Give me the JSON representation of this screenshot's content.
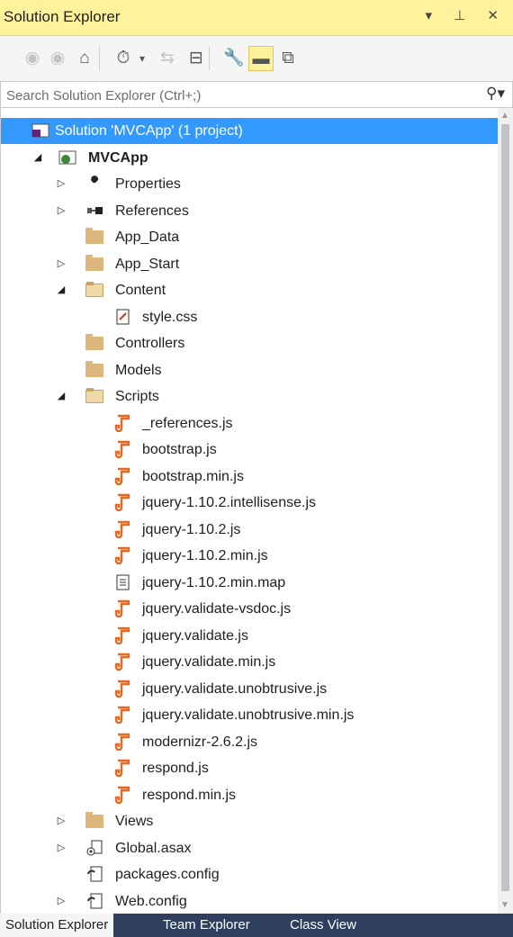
{
  "panel": {
    "title": "Solution Explorer",
    "controls": "▾ ⊥ ✕"
  },
  "toolbar": {
    "buttons": [
      {
        "name": "back-icon",
        "glyph": "◉"
      },
      {
        "name": "forward-icon",
        "glyph": "◉"
      },
      {
        "name": "home-icon",
        "glyph": "⌂"
      },
      {
        "name": "pending-changes-filter-icon",
        "glyph": "⏱"
      },
      {
        "name": "dropdown-icon",
        "glyph": "▾"
      },
      {
        "name": "sync-icon",
        "glyph": "⇆"
      },
      {
        "name": "collapse-all-icon",
        "glyph": "⊟"
      },
      {
        "name": "properties-icon",
        "glyph": "🔧"
      },
      {
        "name": "preview-selected-icon",
        "glyph": "▬"
      },
      {
        "name": "show-all-files-icon",
        "glyph": "⧉"
      }
    ]
  },
  "search": {
    "placeholder": "Search Solution Explorer (Ctrl+;)"
  },
  "tree": [
    {
      "label": "Solution 'MVCApp' (1 project)",
      "icon": "solution-icon",
      "level": 0,
      "arrow": "",
      "selected": true,
      "bold": false
    },
    {
      "label": "MVCApp",
      "icon": "web-project-icon",
      "level": 0,
      "arrow": "◢",
      "selected": false,
      "bold": true
    },
    {
      "label": "Properties",
      "icon": "wrench-icon",
      "level": 1,
      "arrow": "▷",
      "selected": false,
      "bold": false
    },
    {
      "label": "References",
      "icon": "references-icon",
      "level": 1,
      "arrow": "▷",
      "selected": false,
      "bold": false
    },
    {
      "label": "App_Data",
      "icon": "folder-icon",
      "level": 1,
      "arrow": "",
      "selected": false,
      "bold": false
    },
    {
      "label": "App_Start",
      "icon": "folder-icon",
      "level": 1,
      "arrow": "▷",
      "selected": false,
      "bold": false
    },
    {
      "label": "Content",
      "icon": "folder-open-icon",
      "level": 1,
      "arrow": "◢",
      "selected": false,
      "bold": false
    },
    {
      "label": "style.css",
      "icon": "css-file-icon",
      "level": 2,
      "arrow": "",
      "selected": false,
      "bold": false
    },
    {
      "label": "Controllers",
      "icon": "folder-icon",
      "level": 1,
      "arrow": "",
      "selected": false,
      "bold": false
    },
    {
      "label": "Models",
      "icon": "folder-icon",
      "level": 1,
      "arrow": "",
      "selected": false,
      "bold": false
    },
    {
      "label": "Scripts",
      "icon": "folder-open-icon",
      "level": 1,
      "arrow": "◢",
      "selected": false,
      "bold": false
    },
    {
      "label": "_references.js",
      "icon": "js-file-icon",
      "level": 2,
      "arrow": "",
      "selected": false,
      "bold": false
    },
    {
      "label": "bootstrap.js",
      "icon": "js-file-icon",
      "level": 2,
      "arrow": "",
      "selected": false,
      "bold": false
    },
    {
      "label": "bootstrap.min.js",
      "icon": "js-file-icon",
      "level": 2,
      "arrow": "",
      "selected": false,
      "bold": false
    },
    {
      "label": "jquery-1.10.2.intellisense.js",
      "icon": "js-file-icon",
      "level": 2,
      "arrow": "",
      "selected": false,
      "bold": false
    },
    {
      "label": "jquery-1.10.2.js",
      "icon": "js-file-icon",
      "level": 2,
      "arrow": "",
      "selected": false,
      "bold": false
    },
    {
      "label": "jquery-1.10.2.min.js",
      "icon": "js-file-icon",
      "level": 2,
      "arrow": "",
      "selected": false,
      "bold": false
    },
    {
      "label": "jquery-1.10.2.min.map",
      "icon": "map-file-icon",
      "level": 2,
      "arrow": "",
      "selected": false,
      "bold": false
    },
    {
      "label": "jquery.validate-vsdoc.js",
      "icon": "js-file-icon",
      "level": 2,
      "arrow": "",
      "selected": false,
      "bold": false
    },
    {
      "label": "jquery.validate.js",
      "icon": "js-file-icon",
      "level": 2,
      "arrow": "",
      "selected": false,
      "bold": false
    },
    {
      "label": "jquery.validate.min.js",
      "icon": "js-file-icon",
      "level": 2,
      "arrow": "",
      "selected": false,
      "bold": false
    },
    {
      "label": "jquery.validate.unobtrusive.js",
      "icon": "js-file-icon",
      "level": 2,
      "arrow": "",
      "selected": false,
      "bold": false
    },
    {
      "label": "jquery.validate.unobtrusive.min.js",
      "icon": "js-file-icon",
      "level": 2,
      "arrow": "",
      "selected": false,
      "bold": false
    },
    {
      "label": "modernizr-2.6.2.js",
      "icon": "js-file-icon",
      "level": 2,
      "arrow": "",
      "selected": false,
      "bold": false
    },
    {
      "label": "respond.js",
      "icon": "js-file-icon",
      "level": 2,
      "arrow": "",
      "selected": false,
      "bold": false
    },
    {
      "label": "respond.min.js",
      "icon": "js-file-icon",
      "level": 2,
      "arrow": "",
      "selected": false,
      "bold": false
    },
    {
      "label": "Views",
      "icon": "folder-icon",
      "level": 1,
      "arrow": "▷",
      "selected": false,
      "bold": false
    },
    {
      "label": "Global.asax",
      "icon": "asax-file-icon",
      "level": 1,
      "arrow": "▷",
      "selected": false,
      "bold": false
    },
    {
      "label": "packages.config",
      "icon": "config-file-icon",
      "level": 1,
      "arrow": "",
      "selected": false,
      "bold": false
    },
    {
      "label": "Web.config",
      "icon": "config-file-icon",
      "level": 1,
      "arrow": "▷",
      "selected": false,
      "bold": false
    }
  ],
  "tabs": [
    {
      "label": "Solution Explorer",
      "active": true
    },
    {
      "label": "Team Explorer",
      "active": false
    },
    {
      "label": "Class View",
      "active": false
    }
  ],
  "colors": {
    "title_bg": "#fff29d",
    "selection": "#3399ff",
    "js_icon": "#e8661d",
    "folder": "#dcb67a",
    "tab_bar": "#2d3e5f"
  }
}
